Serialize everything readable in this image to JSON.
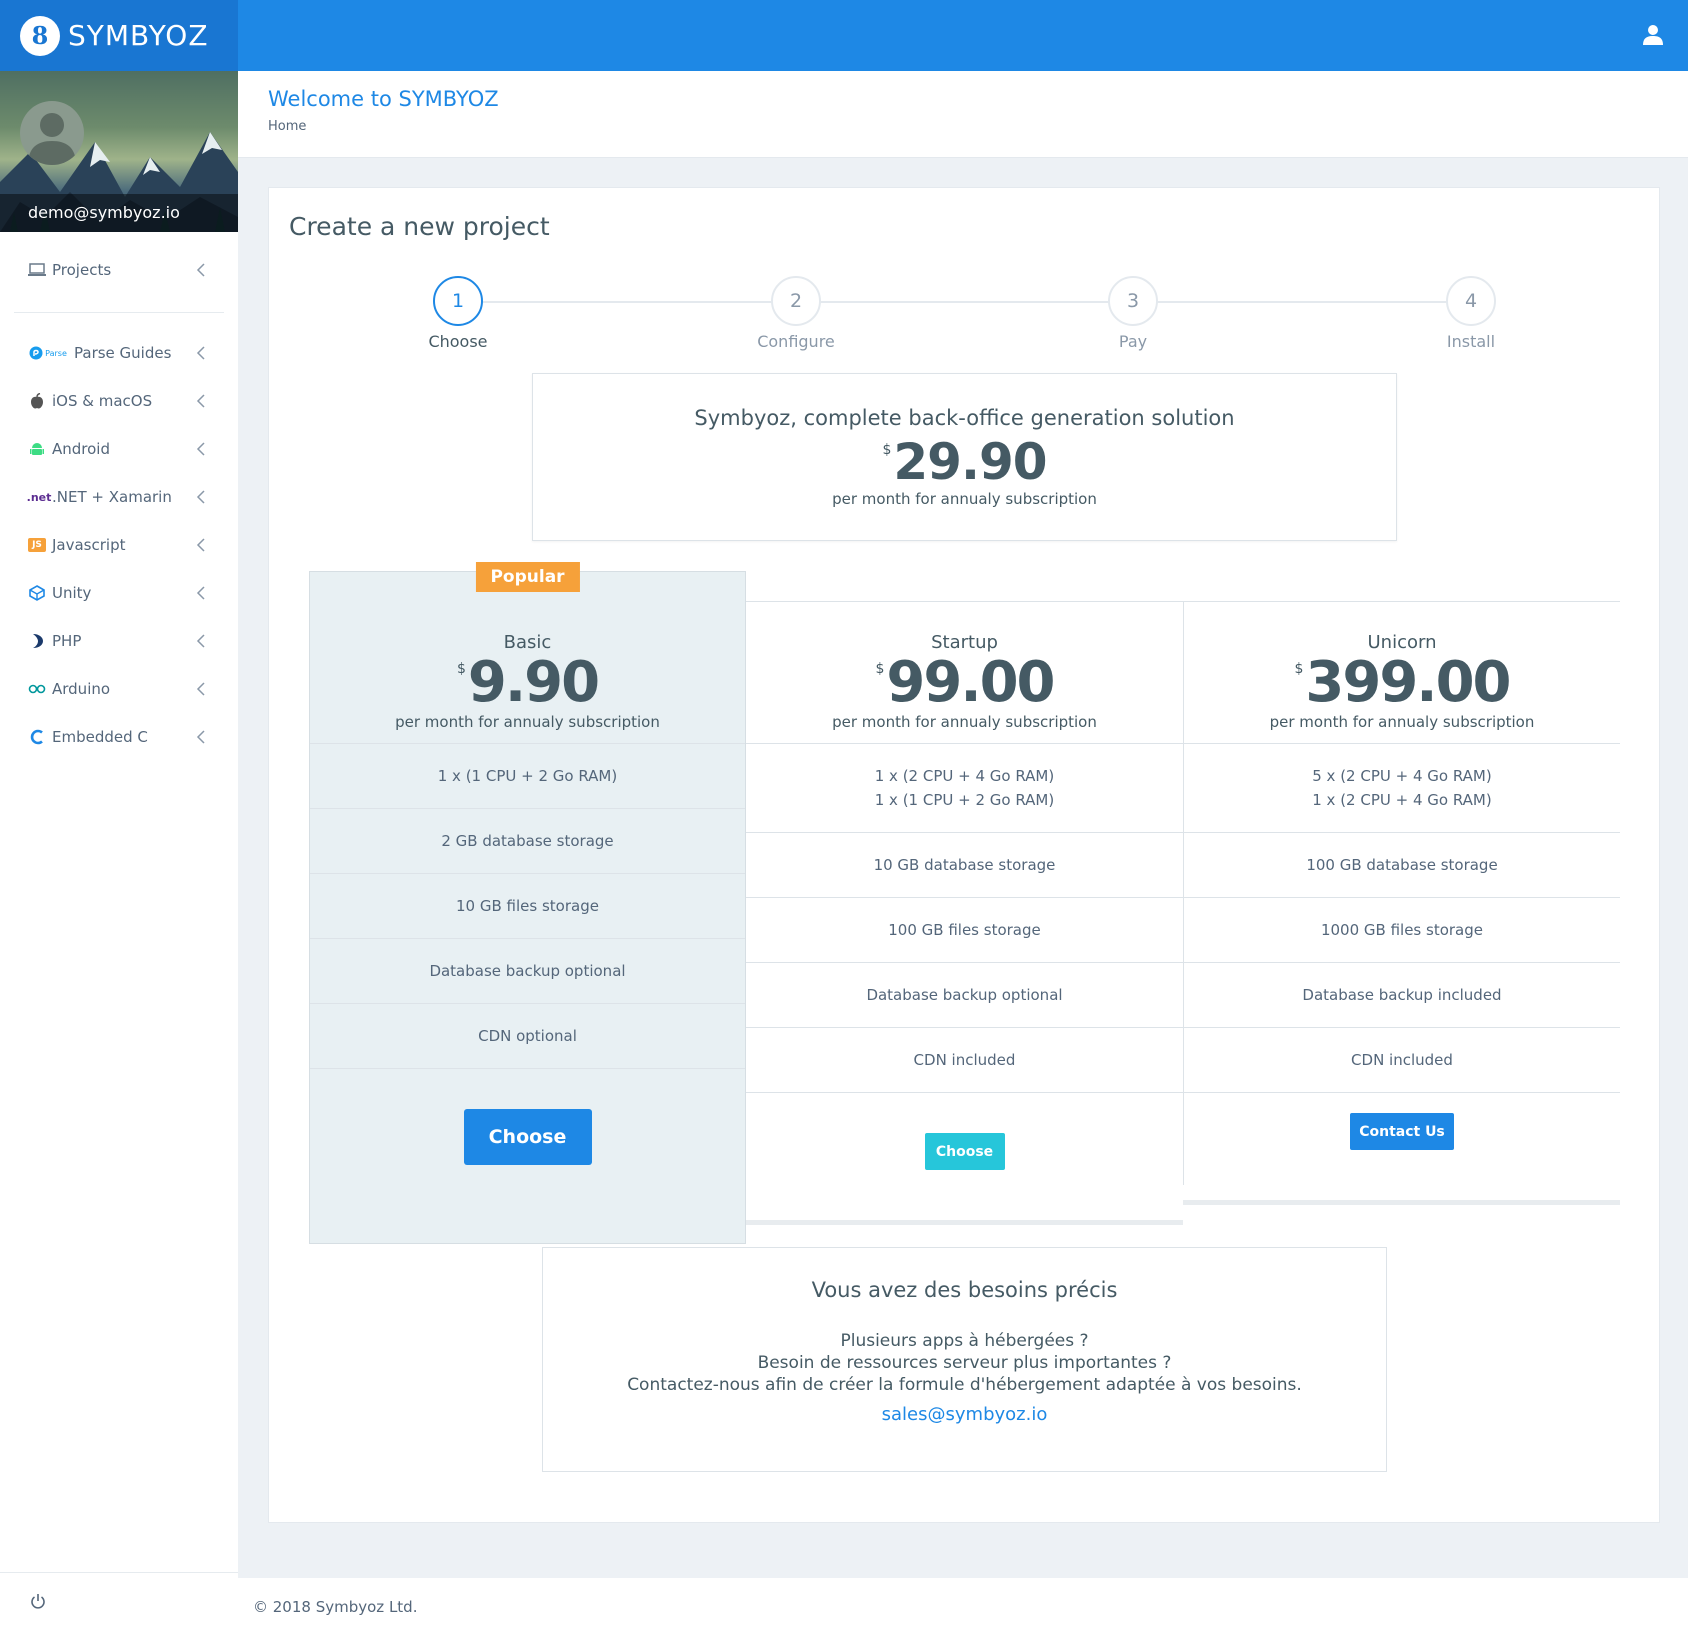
{
  "brand": {
    "logo_letter": "8",
    "name": "SYMBYOZ"
  },
  "user": {
    "email": "demo@symbyoz.io"
  },
  "sidebar": {
    "items": [
      {
        "label": "Projects",
        "icon": "laptop-icon"
      },
      {
        "label": "Parse Guides",
        "icon": "parse-icon",
        "icon_text": "Parse"
      },
      {
        "label": "iOS & macOS",
        "icon": "apple-icon"
      },
      {
        "label": "Android",
        "icon": "android-icon"
      },
      {
        "label": ".NET + Xamarin",
        "icon": "dotnet-icon",
        "icon_text": ".net"
      },
      {
        "label": "Javascript",
        "icon": "js-icon",
        "icon_text": "JS"
      },
      {
        "label": "Unity",
        "icon": "unity-icon"
      },
      {
        "label": "PHP",
        "icon": "php-icon"
      },
      {
        "label": "Arduino",
        "icon": "arduino-icon"
      },
      {
        "label": "Embedded C",
        "icon": "c-icon"
      }
    ]
  },
  "header": {
    "title": "Welcome to SYMBYOZ",
    "breadcrumb": "Home"
  },
  "card": {
    "title": "Create a new project"
  },
  "stepper": {
    "steps": [
      {
        "num": "1",
        "label": "Choose"
      },
      {
        "num": "2",
        "label": "Configure"
      },
      {
        "num": "3",
        "label": "Pay"
      },
      {
        "num": "4",
        "label": "Install"
      }
    ]
  },
  "hero": {
    "title": "Symbyoz, complete back-office generation solution",
    "currency": "$",
    "price": "29.90",
    "subtitle": "per month for annualy subscription"
  },
  "plans": [
    {
      "badge": "Popular",
      "name": "Basic",
      "currency": "$",
      "price": "9.90",
      "subtitle": "per month for annualy subscription",
      "features": [
        "1 x (1 CPU + 2 Go RAM)",
        "2 GB database storage",
        "10 GB files storage",
        "Database backup optional",
        "CDN optional"
      ],
      "button": "Choose"
    },
    {
      "name": "Startup",
      "currency": "$",
      "price": "99.00",
      "subtitle": "per month for annualy subscription",
      "features": [
        "1 x (2 CPU + 4 Go RAM)",
        "1 x (1 CPU + 2 Go RAM)",
        "10 GB database storage",
        "100 GB files storage",
        "Database backup optional",
        "CDN included"
      ],
      "button": "Choose"
    },
    {
      "name": "Unicorn",
      "currency": "$",
      "price": "399.00",
      "subtitle": "per month for annualy subscription",
      "features": [
        "5 x (2 CPU + 4 Go RAM)",
        "1 x (2 CPU + 4 Go RAM)",
        "100 GB database storage",
        "1000 GB files storage",
        "Database backup included",
        "CDN included"
      ],
      "button": "Contact Us"
    }
  ],
  "contact": {
    "title": "Vous avez des besoins précis",
    "line1": "Plusieurs apps à hébergées ?",
    "line2": "Besoin de ressources serveur plus importantes ?",
    "line3": "Contactez-nous afin de créer la formule d'hébergement adaptée à vos besoins.",
    "email": "sales@symbyoz.io"
  },
  "footer": {
    "copyright": "© 2018 Symbyoz Ltd."
  },
  "colors": {
    "primary": "#1e88e5",
    "info": "#26c6da",
    "badge": "#f6a13a"
  }
}
